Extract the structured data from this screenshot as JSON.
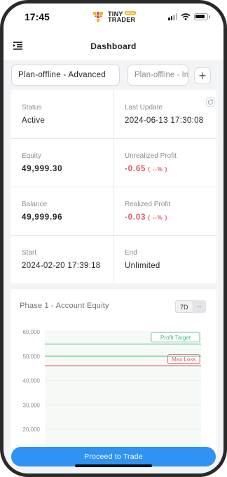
{
  "status_bar": {
    "time": "17:45",
    "brand_line1": "TINY",
    "brand_line2": "TRADER",
    "brand_badge": "BETA"
  },
  "header": {
    "title": "Dashboard",
    "menu_icon": "menu-expand-icon"
  },
  "tabs": [
    {
      "label": "Plan-offline - Advanced",
      "active": true
    },
    {
      "label": "Plan-offline - In",
      "active": false
    }
  ],
  "add_tab_label": "+",
  "account": {
    "status_label": "Status",
    "status_value": "Active",
    "last_update_label": "Last Update",
    "last_update_value": "2024-06-13 17:30:08",
    "equity_label": "Equity",
    "equity_value": "49,999.30",
    "unrealized_label": "Unrealized Profit",
    "unrealized_value": "-0.65",
    "unrealized_pct": "( --% )",
    "balance_label": "Balance",
    "balance_value": "49,999.96",
    "realized_label": "Realized Profit",
    "realized_value": "-0.03",
    "realized_pct": "( --% )",
    "start_label": "Start",
    "start_value": "2024-02-20 17:39:18",
    "end_label": "End",
    "end_value": "Unlimited"
  },
  "equity_chart": {
    "title": "Phase 1 - Account Equity",
    "range_options": [
      "7D",
      "--"
    ],
    "selected_range": "7D"
  },
  "chart_data": {
    "type": "line",
    "title": "Phase 1 - Account Equity",
    "y_ticks": [
      60000,
      50000,
      40000,
      30000,
      20000
    ],
    "y_tick_labels": [
      "60,000",
      "50,000",
      "40,000",
      "30,000",
      "20,000"
    ],
    "ylim": [
      20000,
      60000
    ],
    "reference_lines": [
      {
        "name": "Profit Target",
        "value": 55000,
        "color": "#4dbb86"
      },
      {
        "name": "Max Loss",
        "value": 46000,
        "color": "#e0545e"
      }
    ],
    "series": [
      {
        "values": [
          50000,
          50000,
          50000,
          50000,
          50000,
          50000,
          50000,
          49999.3
        ],
        "color": "#4dbb86"
      }
    ],
    "grid": true
  },
  "footer": {
    "proceed_label": "Proceed to Trade"
  },
  "colors": {
    "accent": "#2e93f5",
    "negative": "#e0545e",
    "positive": "#4dbb86"
  }
}
